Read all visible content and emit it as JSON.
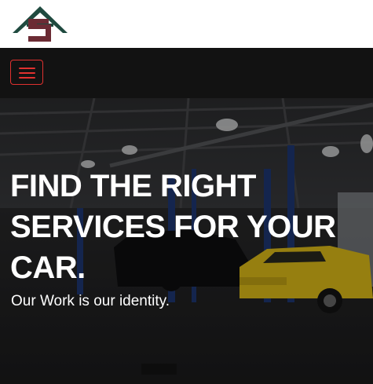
{
  "brand": {
    "logo_icon": "house-s-logo-icon",
    "logo_colors": {
      "roof": "#1f4a3f",
      "letter": "#6b2b34"
    }
  },
  "nav": {
    "menu_icon": "hamburger-menu-icon",
    "accent": "#e0312f",
    "bar_bg": "#121212"
  },
  "hero": {
    "title": "FIND THE RIGHT SERVICES FOR YOUR CAR.",
    "subtitle": "Our Work is our identity.",
    "background": "auto-repair-garage-photo"
  }
}
